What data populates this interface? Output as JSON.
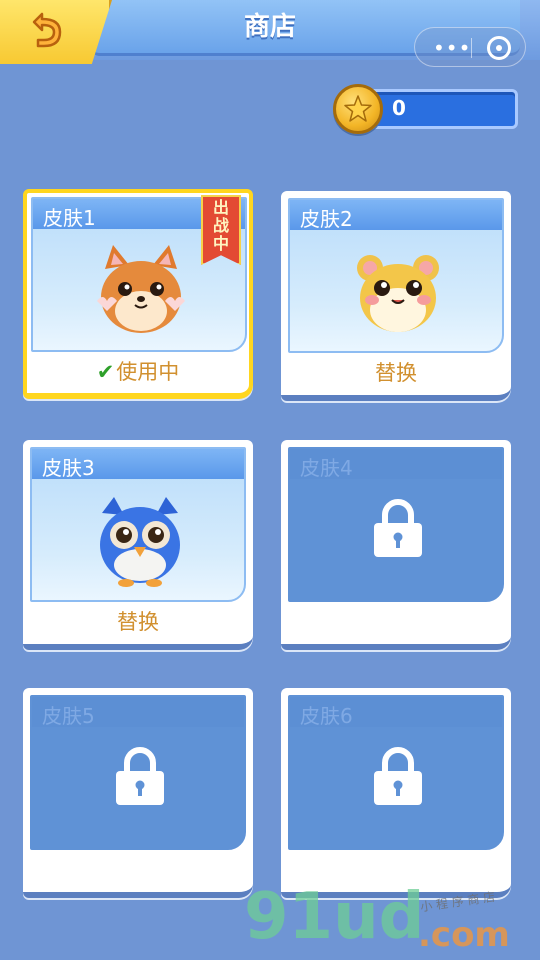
{
  "header": {
    "title": "商店",
    "back_icon": "back-arrow-icon",
    "capsule_more": "•••",
    "capsule_close_icon": "target-icon"
  },
  "currency": {
    "icon": "star-coin-icon",
    "value": "0"
  },
  "skins": [
    {
      "label": "皮肤1",
      "action": "使用中",
      "status": "in-use",
      "badge": "出战中",
      "pet": "fox"
    },
    {
      "label": "皮肤2",
      "action": "替换",
      "status": "unlocked",
      "pet": "hamster"
    },
    {
      "label": "皮肤3",
      "action": "替换",
      "status": "unlocked",
      "pet": "owl"
    },
    {
      "label": "皮肤4",
      "action": "",
      "status": "locked"
    },
    {
      "label": "皮肤5",
      "action": "",
      "status": "locked"
    },
    {
      "label": "皮肤6",
      "action": "",
      "status": "locked"
    }
  ],
  "watermark": {
    "main": "91ud",
    "suffix": ".com",
    "tagline": "小 程 序 商 店"
  },
  "colors": {
    "background": "#6f95d4",
    "accent_yellow": "#ffd61f",
    "action_text": "#d1902f",
    "check_green": "#2ea02a"
  }
}
